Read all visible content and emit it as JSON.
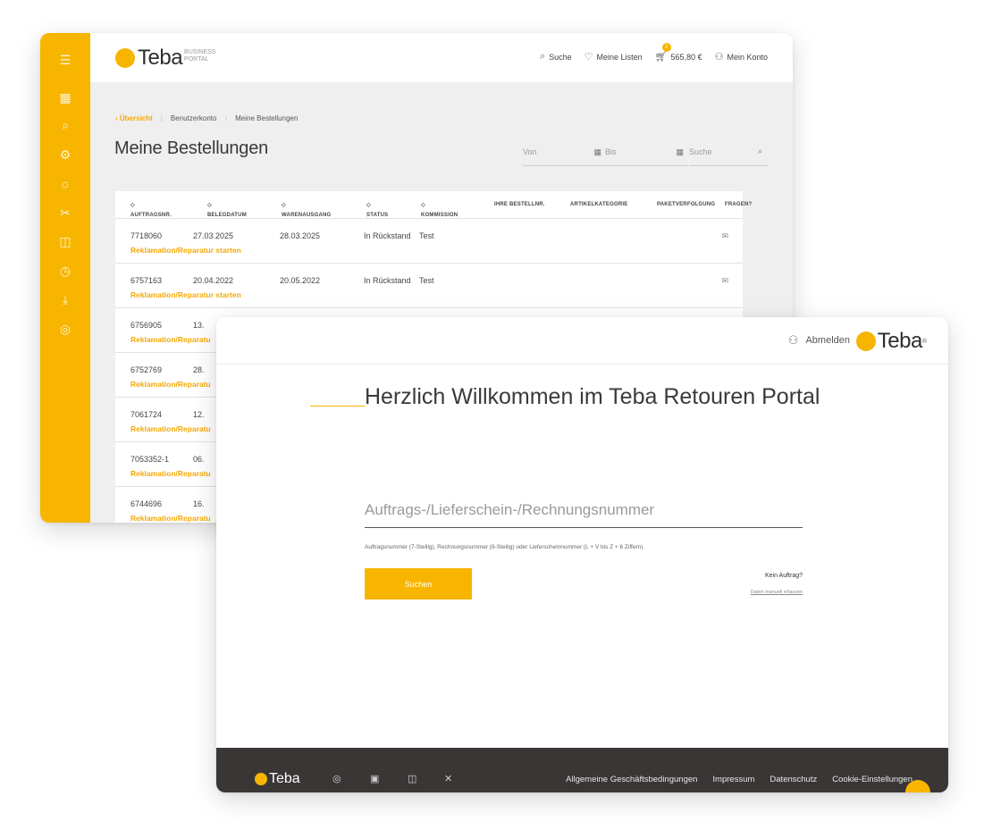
{
  "back_window": {
    "logo": {
      "word": "Teba",
      "sub_line1": "BUSINESS",
      "sub_line2": "PORTAL"
    },
    "nav": {
      "search": "Suche",
      "lists": "Meine Listen",
      "cart_count": "2",
      "cart_total": "565,80 €",
      "account": "Mein Konto"
    },
    "breadcrumb": {
      "back": "Übersicht",
      "item1": "Benutzerkonto",
      "item2": "Meine Bestellungen"
    },
    "title": "Meine Bestellungen",
    "filters": {
      "from": "Von",
      "to": "Bis",
      "search": "Suche"
    },
    "columns": [
      "AUFTRAGSNR.",
      "BELEGDATUM",
      "WARENAUSGANG",
      "STATUS",
      "KOMMISSION",
      "IHRE BESTELLNR.",
      "ARTIKELKATEGORIE",
      "PAKETVERFOLGUNG",
      "FRAGEN?"
    ],
    "action_label": "Reklamation/Reparatur starten",
    "action_label_cut": "Reklamation/Reparatu",
    "rows": [
      {
        "nr": "7718060",
        "date": "27.03.2025",
        "out": "28.03.2025",
        "status": "In Rückstand",
        "kom": "Test"
      },
      {
        "nr": "6757163",
        "date": "20.04.2022",
        "out": "20.05.2022",
        "status": "In Rückstand",
        "kom": "Test"
      },
      {
        "nr": "6756905",
        "date": "13."
      },
      {
        "nr": "6752769",
        "date": "28."
      },
      {
        "nr": "7061724",
        "date": "12."
      },
      {
        "nr": "7053352-1",
        "date": "06."
      },
      {
        "nr": "6744696",
        "date": "16."
      }
    ]
  },
  "front_window": {
    "logout": "Abmelden",
    "logo_word": "Teba",
    "heading": "Herzlich Willkommen im Teba Retouren Portal",
    "input_placeholder": "Auftrags-/Lieferschein-/Rechnungsnummer",
    "hint": "Auftragsnummer (7-Stellig), Rechnungsnummer (8-Stellig) oder Lieferscheinnummer (L + V bis Z + 6 Ziffern)",
    "search_button": "Suchen",
    "no_order": "Kein Auftrag?",
    "manual_entry": "Daten manuell erfassen",
    "footer": {
      "logo_word": "Teba",
      "links": [
        "Allgemeine Geschäftsbedingungen",
        "Impressum",
        "Datenschutz",
        "Cookie-Einstellungen"
      ]
    }
  },
  "colors": {
    "accent": "#f7b500",
    "footer": "#3a3636",
    "text": "#3a3a3a"
  }
}
